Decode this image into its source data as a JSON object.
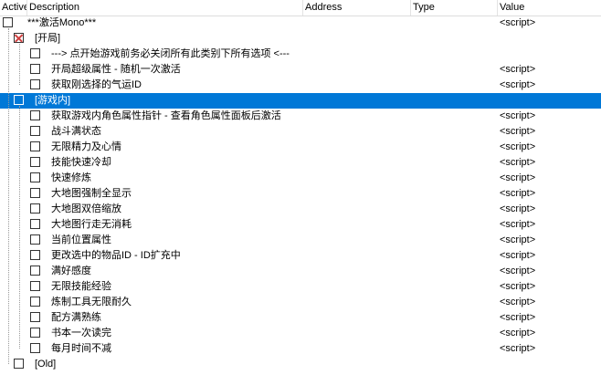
{
  "columns": {
    "active": "Active",
    "description": "Description",
    "address": "Address",
    "type": "Type",
    "value": "Value"
  },
  "rows": [
    {
      "desc": "***激活Mono***",
      "value": "<script>",
      "indent": 0,
      "checkbox": "empty"
    },
    {
      "desc": "[开局]",
      "value": "",
      "indent": 1,
      "checkbox": "x"
    },
    {
      "desc": "--->    点开始游戏前务必关闭所有此类别下所有选项    <---",
      "value": "",
      "indent": 2,
      "checkbox": "empty"
    },
    {
      "desc": "开局超级属性 - 随机一次激活",
      "value": "<script>",
      "indent": 2,
      "checkbox": "empty"
    },
    {
      "desc": "获取刚选择的气运ID",
      "value": "<script>",
      "indent": 2,
      "checkbox": "empty"
    },
    {
      "desc": "[游戏内]",
      "value": "",
      "indent": 1,
      "checkbox": "empty",
      "selected": true
    },
    {
      "desc": "获取游戏内角色属性指针 - 查看角色属性面板后激活",
      "value": "<script>",
      "indent": 2,
      "checkbox": "empty"
    },
    {
      "desc": "战斗满状态",
      "value": "<script>",
      "indent": 2,
      "checkbox": "empty"
    },
    {
      "desc": "无限精力及心情",
      "value": "<script>",
      "indent": 2,
      "checkbox": "empty"
    },
    {
      "desc": "技能快速冷却",
      "value": "<script>",
      "indent": 2,
      "checkbox": "empty"
    },
    {
      "desc": "快速修炼",
      "value": "<script>",
      "indent": 2,
      "checkbox": "empty"
    },
    {
      "desc": "大地图强制全显示",
      "value": "<script>",
      "indent": 2,
      "checkbox": "empty"
    },
    {
      "desc": "大地图双倍缩放",
      "value": "<script>",
      "indent": 2,
      "checkbox": "empty"
    },
    {
      "desc": "大地图行走无消耗",
      "value": "<script>",
      "indent": 2,
      "checkbox": "empty"
    },
    {
      "desc": "当前位置属性",
      "value": "<script>",
      "indent": 2,
      "checkbox": "empty"
    },
    {
      "desc": "更改选中的物品ID - ID扩充中",
      "value": "<script>",
      "indent": 2,
      "checkbox": "empty"
    },
    {
      "desc": "满好感度",
      "value": "<script>",
      "indent": 2,
      "checkbox": "empty"
    },
    {
      "desc": "无限技能经验",
      "value": "<script>",
      "indent": 2,
      "checkbox": "empty"
    },
    {
      "desc": "炼制工具无限耐久",
      "value": "<script>",
      "indent": 2,
      "checkbox": "empty"
    },
    {
      "desc": "配方满熟练",
      "value": "<script>",
      "indent": 2,
      "checkbox": "empty"
    },
    {
      "desc": "书本一次读完",
      "value": "<script>",
      "indent": 2,
      "checkbox": "empty"
    },
    {
      "desc": "每月时间不减",
      "value": "<script>",
      "indent": 2,
      "checkbox": "empty"
    },
    {
      "desc": "[Old]",
      "value": "",
      "indent": 1,
      "checkbox": "empty"
    }
  ],
  "colors": {
    "selected": "#0078d7",
    "x_mark": "#d04040"
  }
}
